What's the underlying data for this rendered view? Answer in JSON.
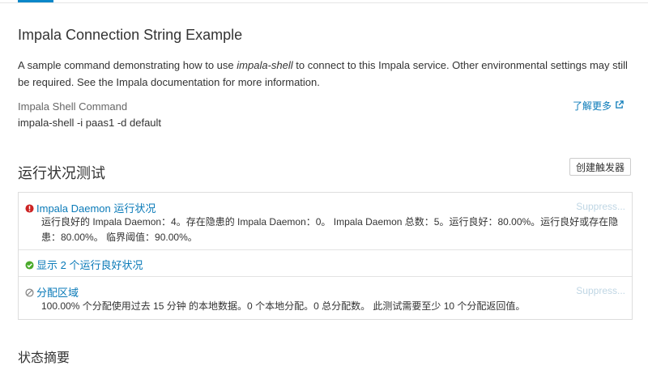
{
  "connection": {
    "title": "Impala Connection String Example",
    "desc_prefix": "A sample command demonstrating how to use ",
    "desc_em": "impala-shell",
    "desc_suffix": " to connect to this Impala service. Other environmental settings may still be required. See the Impala documentation for more information.",
    "command_label": "Impala Shell Command",
    "command_value": "impala-shell -i paas1 -d default",
    "learn_more": "了解更多"
  },
  "health": {
    "title": "运行状况测试",
    "create_trigger": "创建触发器",
    "tests": [
      {
        "status": "bad",
        "icon": "error-icon",
        "title": "Impala Daemon 运行状况",
        "text": "运行良好的 Impala Daemon：4。存在隐患的 Impala Daemon：0。 Impala Daemon 总数：5。运行良好：80.00%。运行良好或存在隐患：80.00%。 临界阈值：90.00%。",
        "suppress": "Suppress..."
      },
      {
        "status": "good",
        "icon": "check-circle-icon",
        "title": "显示 2 个运行良好状况"
      },
      {
        "status": "disabled",
        "icon": "disabled-icon",
        "title": "分配区域",
        "text": "100.00% 个分配使用过去 15 分钟 的本地数据。0 个本地分配。0 总分配数。 此测试需要至少 10 个分配返回值。",
        "suppress": "Suppress..."
      }
    ]
  },
  "colors": {
    "link": "#0a7ab8",
    "error": "#cc2222",
    "good": "#4aaa2c",
    "disabled": "#888888"
  },
  "next_section": {
    "title": "状态摘要"
  }
}
